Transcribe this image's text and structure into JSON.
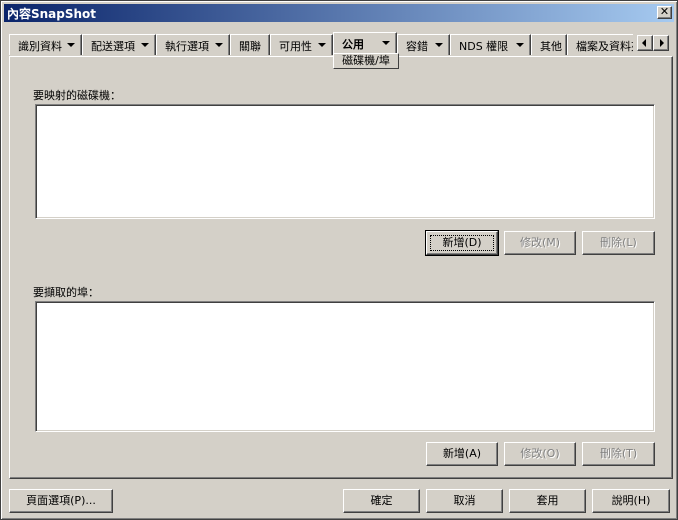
{
  "window": {
    "title": "內容SnapShot",
    "close_glyph": "✕"
  },
  "tabs": [
    {
      "label": "識別資料",
      "has_menu": true
    },
    {
      "label": "配送選項",
      "has_menu": true
    },
    {
      "label": "執行選項",
      "has_menu": true
    },
    {
      "label": "關聯",
      "has_menu": false
    },
    {
      "label": "可用性",
      "has_menu": true
    },
    {
      "label": "公用",
      "has_menu": true,
      "active": true
    },
    {
      "label": "容錯",
      "has_menu": true
    },
    {
      "label": "NDS 權限",
      "has_menu": true
    },
    {
      "label": "其他",
      "has_menu": false
    },
    {
      "label": "檔案及資料夾",
      "has_menu": false
    }
  ],
  "active_subtab": "磁碟機/埠",
  "drives_section": {
    "label": "要映射的磁碟機：",
    "add_label": "新增(D)",
    "modify_label": "修改(M)",
    "delete_label": "刪除(L)"
  },
  "ports_section": {
    "label": "要擷取的埠：",
    "add_label": "新增(A)",
    "modify_label": "修改(O)",
    "delete_label": "刪除(T)"
  },
  "footer": {
    "page_options_label": "頁面選項(P)...",
    "ok_label": "確定",
    "cancel_label": "取消",
    "apply_label": "套用",
    "help_label": "說明(H)"
  }
}
